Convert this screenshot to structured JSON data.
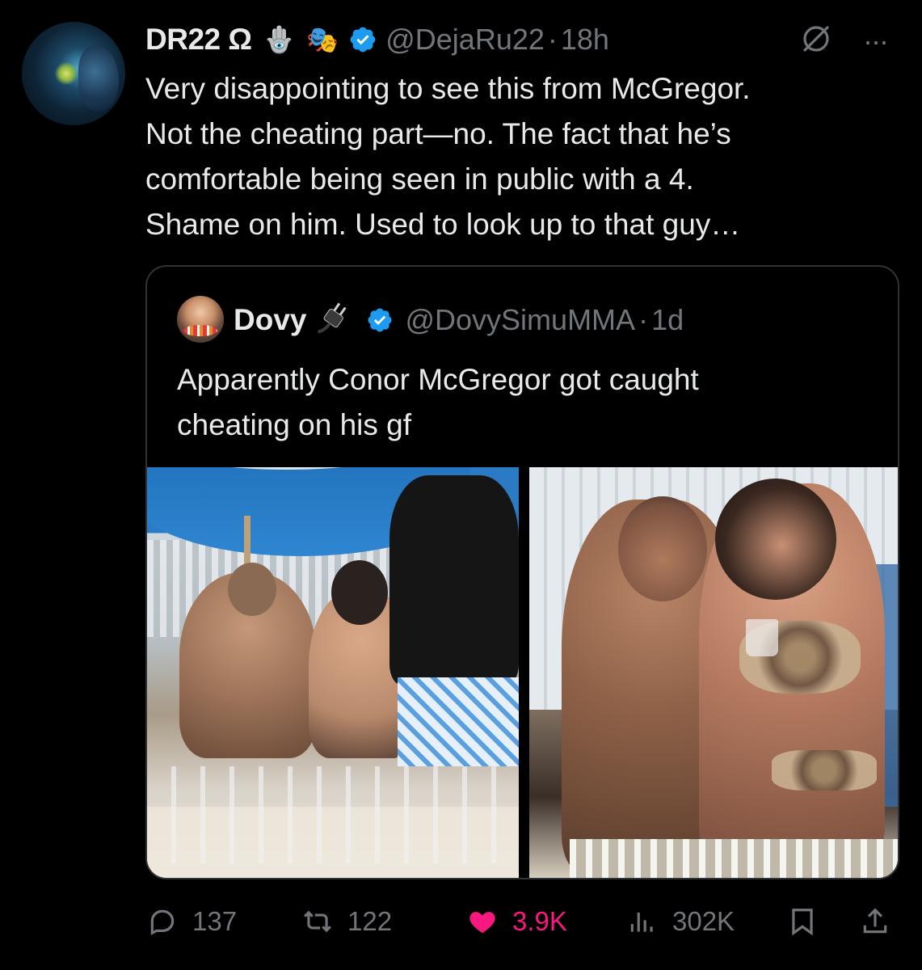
{
  "tweet": {
    "display_name": "DR22 Ω",
    "emojis": [
      "🪬",
      "🎭"
    ],
    "handle": "@DejaRu22",
    "separator": "·",
    "time": "18h",
    "text_lines": [
      "Very disappointing to see this from McGregor.",
      "Not the cheating part—no. The fact that he’s",
      "comfortable being seen in public with a 4.",
      "Shame on him. Used to look up to that guy…"
    ],
    "more_label": "···"
  },
  "quoted": {
    "display_name": "Dovy",
    "handle": "@DovySimuMMA",
    "separator": "·",
    "time": "1d",
    "text_lines": [
      "Apparently Conor McGregor got caught",
      "cheating on his gf"
    ]
  },
  "actions": {
    "replies": "137",
    "reposts": "122",
    "likes": "3.9K",
    "views": "302K"
  },
  "colors": {
    "background": "#000000",
    "text": "#e7e9ea",
    "muted": "#71767b",
    "verified": "#1d9bf0",
    "like": "#f91880",
    "border": "#2f3336"
  },
  "icons": [
    "grok-icon",
    "more-icon",
    "verified-icon",
    "plug-icon",
    "reply-icon",
    "repost-icon",
    "heart-icon",
    "views-icon",
    "bookmark-icon",
    "share-icon"
  ]
}
